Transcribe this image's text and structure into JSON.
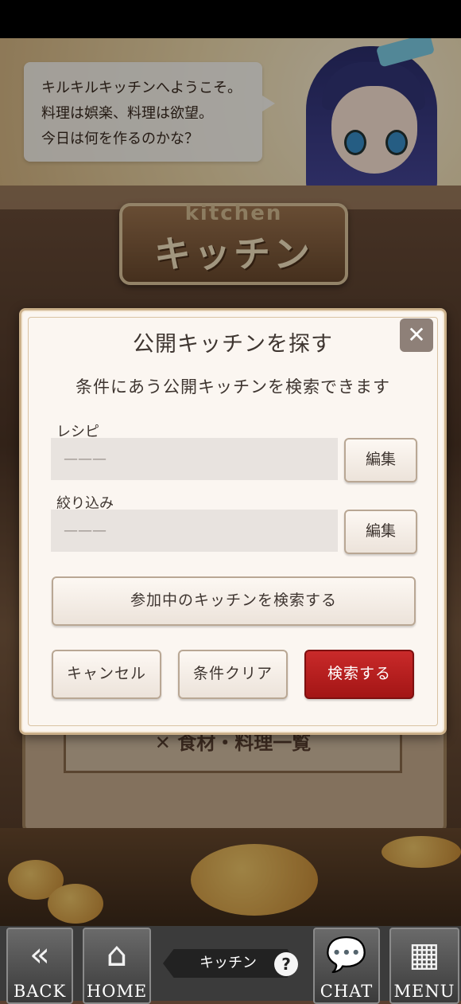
{
  "speech": {
    "lines": [
      "キルキルキッチンへようこそ。",
      "料理は娯楽、料理は欲望。",
      "今日は何を作るのかな？"
    ]
  },
  "plaque": {
    "subtitle": "kitchen",
    "title": "キッチン"
  },
  "background_menu": {
    "list_button": "✕ 食材・料理一覧"
  },
  "dialog": {
    "title": "公開キッチンを探す",
    "close_symbol": "✕",
    "description": "条件にあう公開キッチンを検索できます",
    "recipe": {
      "label": "レシピ",
      "value": "———",
      "edit": "編集"
    },
    "filter": {
      "label": "絞り込み",
      "value": "———",
      "edit": "編集"
    },
    "search_joined": "参加中のキッチンを検索する",
    "cancel": "キャンセル",
    "clear": "条件クリア",
    "search": "検索する"
  },
  "nav": {
    "back": "BACK",
    "home": "HOME",
    "page_label": "キッチン",
    "help": "?",
    "chat": "CHAT",
    "menu": "MENU"
  },
  "icons": {
    "back": "double-chevron-left-icon",
    "home": "house-icon",
    "chat": "speech-bubble-icon",
    "menu": "grid-icon"
  },
  "colors": {
    "primary_button": "#b51e1e",
    "dialog_bg": "#fbf6f1",
    "nav_bg": "#3b3b3b"
  }
}
